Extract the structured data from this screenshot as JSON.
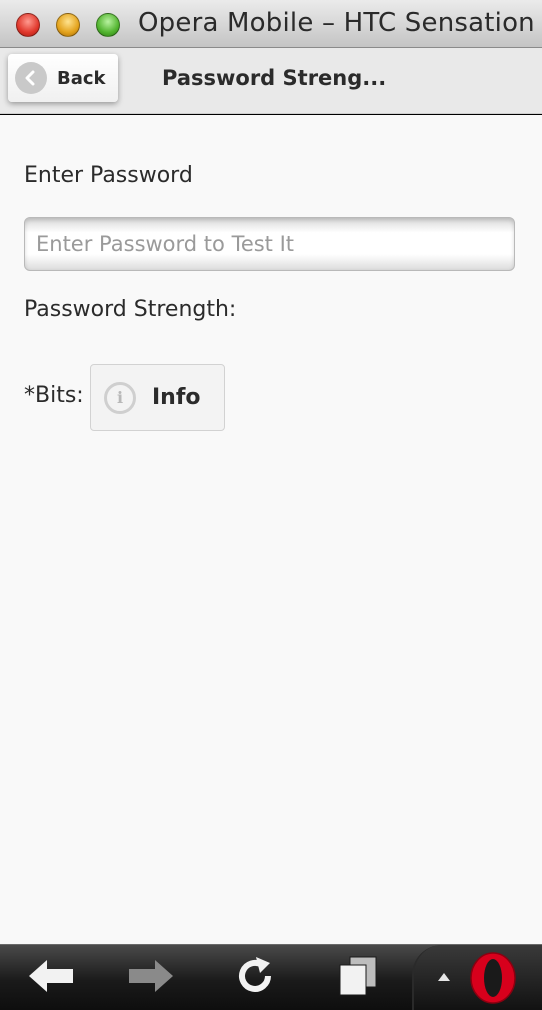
{
  "window": {
    "title": "Opera Mobile – HTC Sensation"
  },
  "header": {
    "back_label": "Back",
    "page_title": "Password Streng..."
  },
  "form": {
    "password_label": "Enter Password",
    "password_placeholder": "Enter Password to Test It",
    "password_value": "",
    "strength_label": "Password Strength:",
    "bits_label": "*Bits:",
    "info_button_label": "Info"
  },
  "icons": {
    "back": "chevron-left-icon",
    "info": "info-icon",
    "toolbar": [
      "arrow-left-icon",
      "arrow-right-icon",
      "reload-icon",
      "tabs-icon",
      "caret-up-icon",
      "opera-logo-icon"
    ]
  },
  "colors": {
    "window_chrome": "#c4c4c4",
    "header_bg": "#e9e9e9",
    "page_bg": "#f9f9f9",
    "toolbar_bg": "#1a1a1a",
    "opera_red": "#d7001c"
  }
}
